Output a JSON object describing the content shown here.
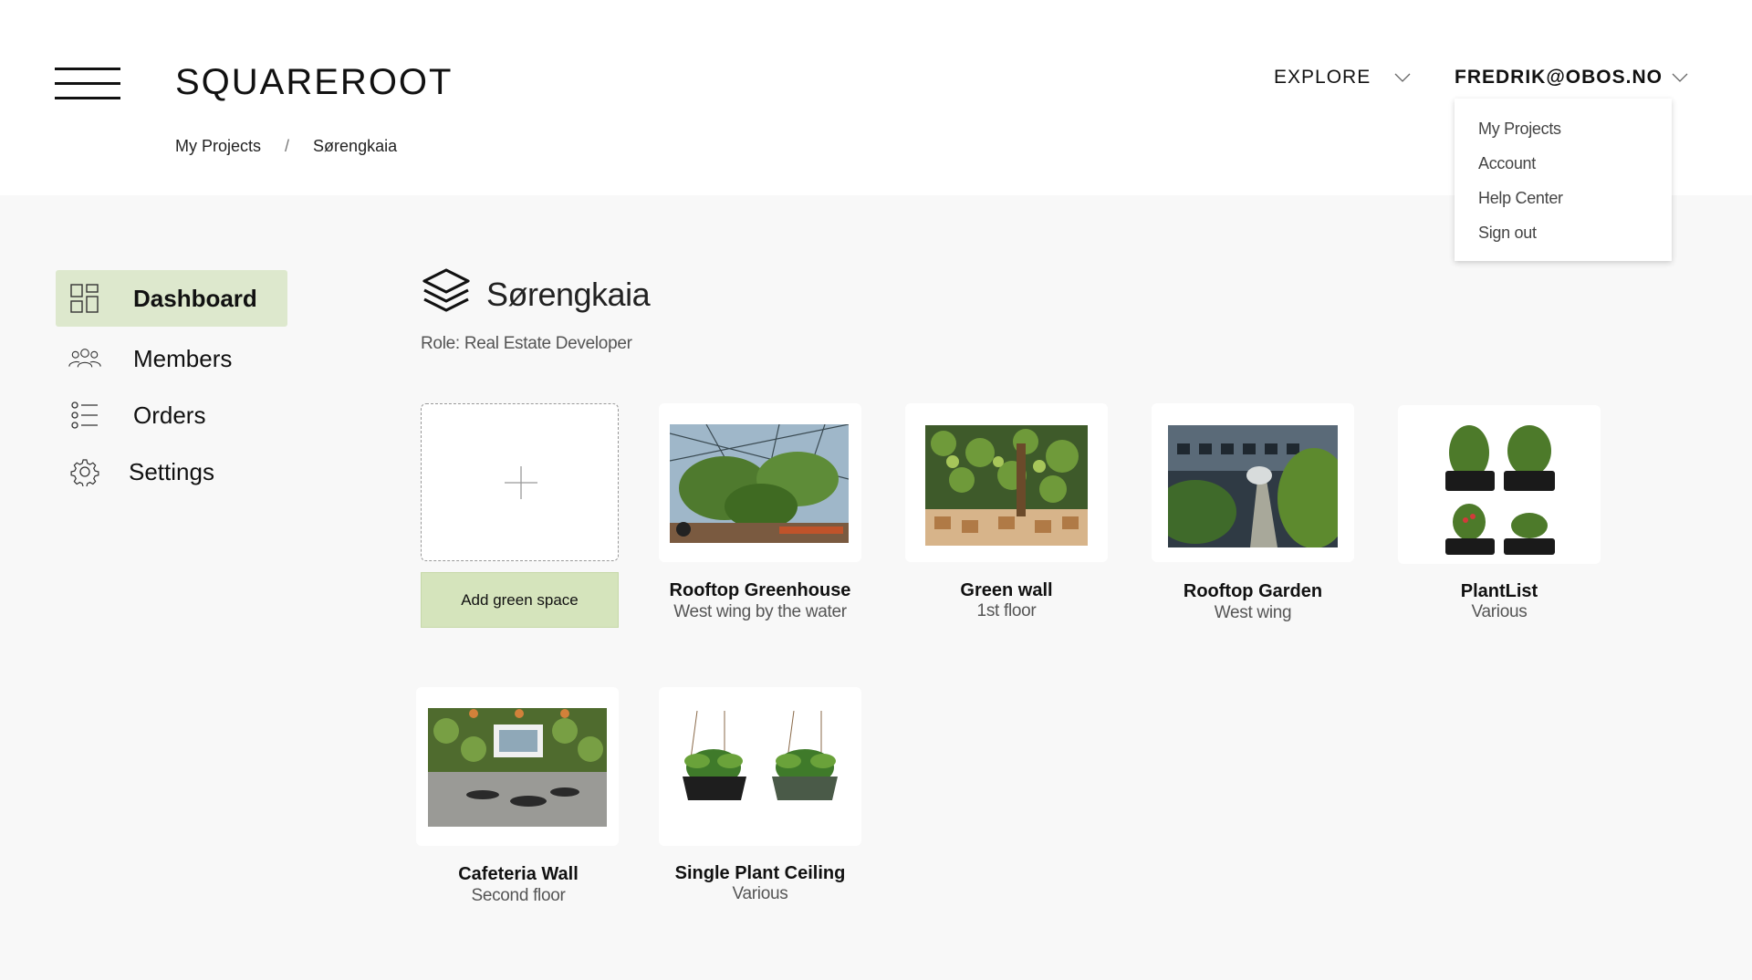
{
  "header": {
    "brand": "SQUAREROOT",
    "breadcrumb": {
      "root": "My Projects",
      "separator": "/",
      "current": "Sørengkaia"
    },
    "explore_label": "EXPLORE",
    "user_email": "FREDRIK@OBOS.NO"
  },
  "user_menu": {
    "items": [
      "My Projects",
      "Account",
      "Help Center",
      "Sign out"
    ]
  },
  "sidebar": {
    "items": [
      {
        "label": "Dashboard",
        "icon": "dashboard-icon",
        "active": true
      },
      {
        "label": "Members",
        "icon": "members-icon",
        "active": false
      },
      {
        "label": "Orders",
        "icon": "orders-icon",
        "active": false
      },
      {
        "label": "Settings",
        "icon": "gear-icon",
        "active": false
      }
    ]
  },
  "project": {
    "name": "Sørengkaia",
    "role": "Role: Real Estate Developer",
    "add_button": "Add green space"
  },
  "spaces": [
    {
      "title": "Rooftop Greenhouse",
      "subtitle": "West wing by the water"
    },
    {
      "title": "Green wall",
      "subtitle": "1st floor"
    },
    {
      "title": "Rooftop Garden",
      "subtitle": "West wing"
    },
    {
      "title": "PlantList",
      "subtitle": "Various"
    },
    {
      "title": "Cafeteria Wall",
      "subtitle": "Second floor"
    },
    {
      "title": "Single Plant Ceiling",
      "subtitle": "Various"
    }
  ],
  "colors": {
    "accent_active": "#dde8cd",
    "add_button": "#d5e4bc",
    "background": "#f8f8f8"
  }
}
